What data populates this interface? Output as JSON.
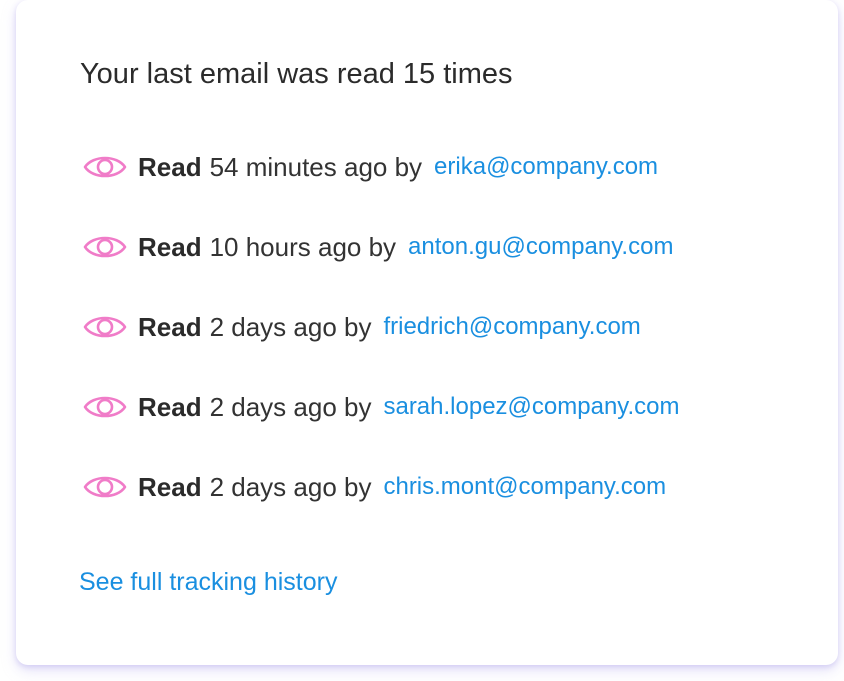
{
  "title": "Your last email was read 15 times",
  "reads": [
    {
      "label": "Read",
      "when": "54 minutes ago by",
      "email": "erika@company.com",
      "icon": "eye-icon"
    },
    {
      "label": "Read",
      "when": "10 hours ago by",
      "email": "anton.gu@company.com",
      "icon": "eye-icon"
    },
    {
      "label": "Read",
      "when": "2 days ago by",
      "email": "friedrich@company.com",
      "icon": "eye-icon"
    },
    {
      "label": "Read",
      "when": "2 days ago by",
      "email": "sarah.lopez@company.com",
      "icon": "eye-icon"
    },
    {
      "label": "Read",
      "when": "2 days ago by",
      "email": "chris.mont@company.com",
      "icon": "eye-icon"
    }
  ],
  "history_link": "See full tracking history",
  "colors": {
    "link": "#1a8fe0",
    "eye": "#f07cc8",
    "text": "#2b2b2b"
  }
}
